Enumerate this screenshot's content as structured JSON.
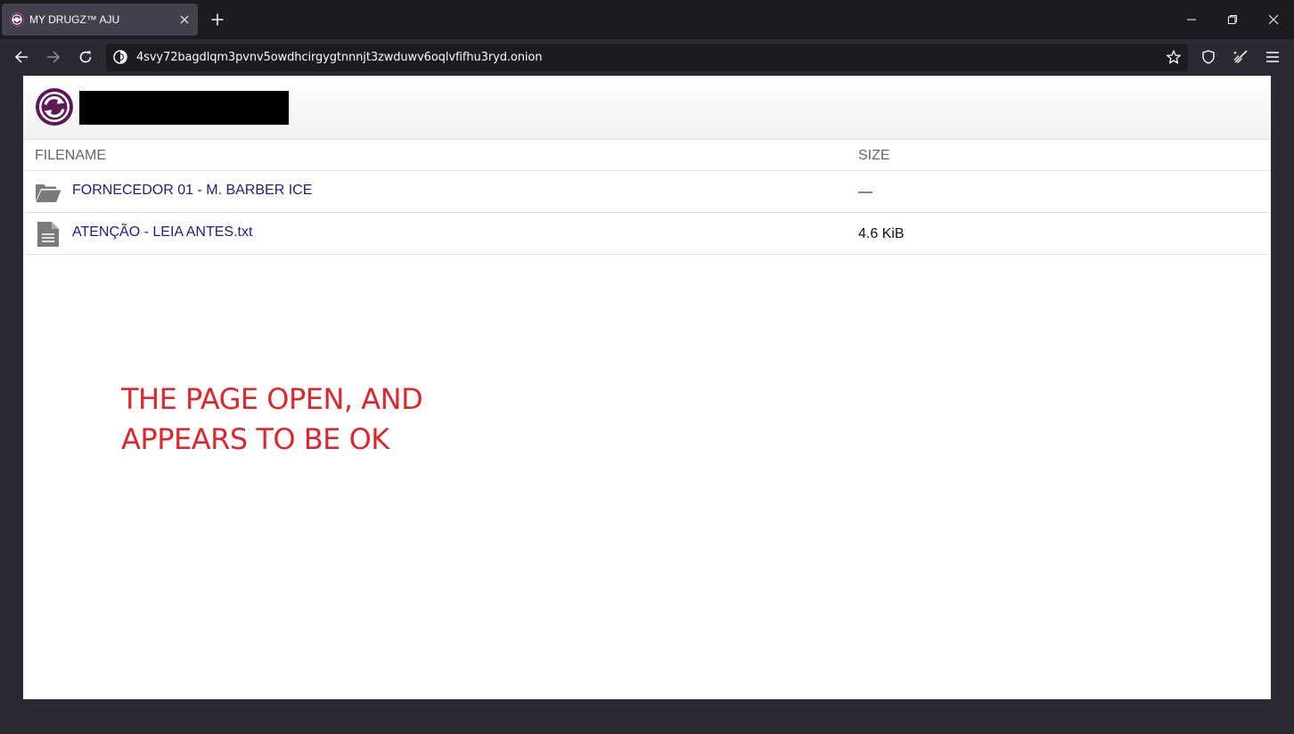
{
  "browser": {
    "tab": {
      "title": "MY DRUGZ™ AJU",
      "favicon": "rotating-arrows-icon",
      "close": "close-icon"
    },
    "new_tab": "plus-icon",
    "window_controls": [
      "minimize-icon",
      "restore-icon",
      "close-icon"
    ],
    "nav": {
      "back": "arrow-left-icon",
      "forward": "arrow-right-icon",
      "reload": "reload-icon"
    },
    "url": "4svy72bagdlqm3pvnv5owdhcirgygtnnnjt3zwduwv6oqlvfifhu3ryd.onion",
    "toolbar_icons": [
      "star-icon",
      "shield-icon",
      "broom-icon",
      "hamburger-menu-icon"
    ]
  },
  "page": {
    "logo": "rotating-arrows-logo",
    "columns": {
      "name": "FILENAME",
      "size": "SIZE"
    },
    "files": [
      {
        "name": "FORNECEDOR 01 - M. BARBER ICE",
        "size": "—",
        "icon": "folder-icon"
      },
      {
        "name": "ATENÇÃO - LEIA ANTES.txt",
        "size": "4.6 KiB",
        "icon": "text-file-icon"
      }
    ],
    "annotation": {
      "line1": "THE PAGE OPEN, AND",
      "line2": "APPEARS TO BE OK"
    }
  },
  "colors": {
    "accent": "#5b1a57",
    "link": "#1e1e7a",
    "annotation": "#d9282f",
    "chrome_dark": "#1c1b22",
    "chrome": "#2b2a33"
  }
}
